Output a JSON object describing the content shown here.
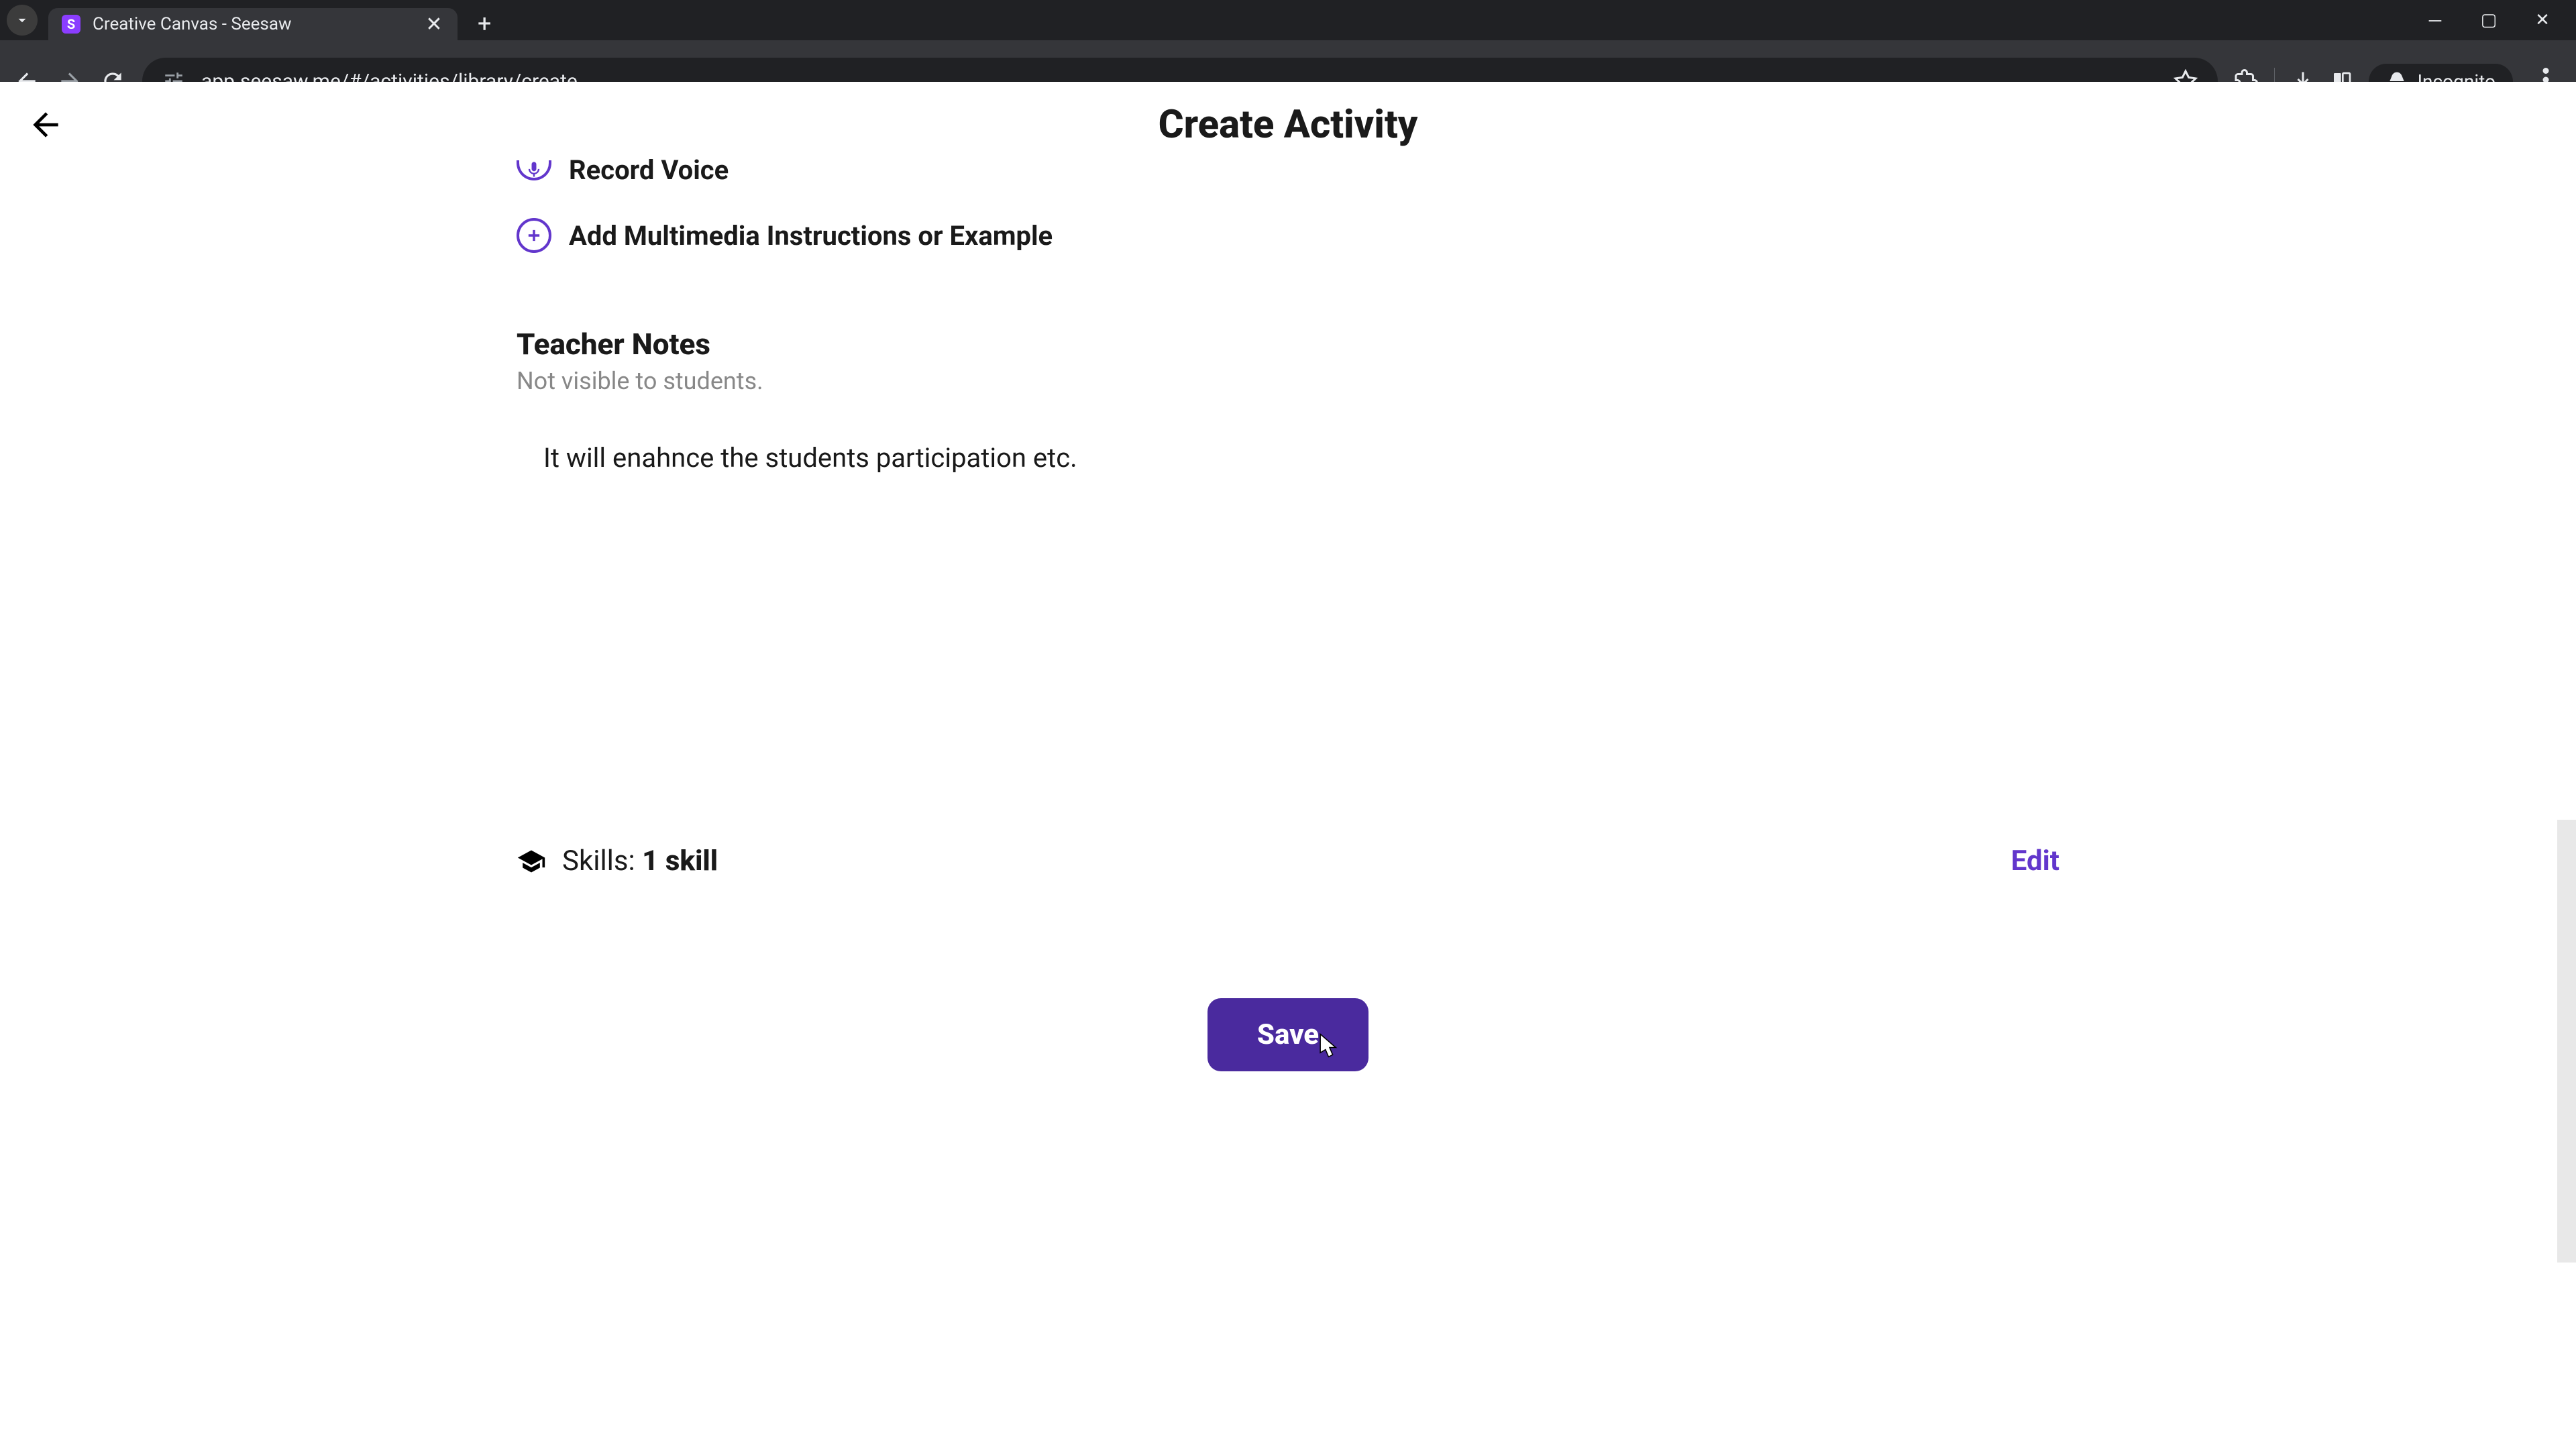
{
  "browser": {
    "tab_title": "Creative Canvas - Seesaw",
    "url": "app.seesaw.me/#/activities/library/create",
    "incognito_label": "Incognito"
  },
  "page": {
    "title": "Create Activity",
    "record_voice_label": "Record Voice",
    "add_multimedia_label": "Add Multimedia Instructions or Example"
  },
  "teacher_notes": {
    "title": "Teacher Notes",
    "subtitle": "Not visible to students.",
    "content": "It will enahnce the students participation etc."
  },
  "skills": {
    "label": "Skills: ",
    "count_text": "1 skill",
    "edit_label": "Edit"
  },
  "buttons": {
    "save": "Save"
  }
}
